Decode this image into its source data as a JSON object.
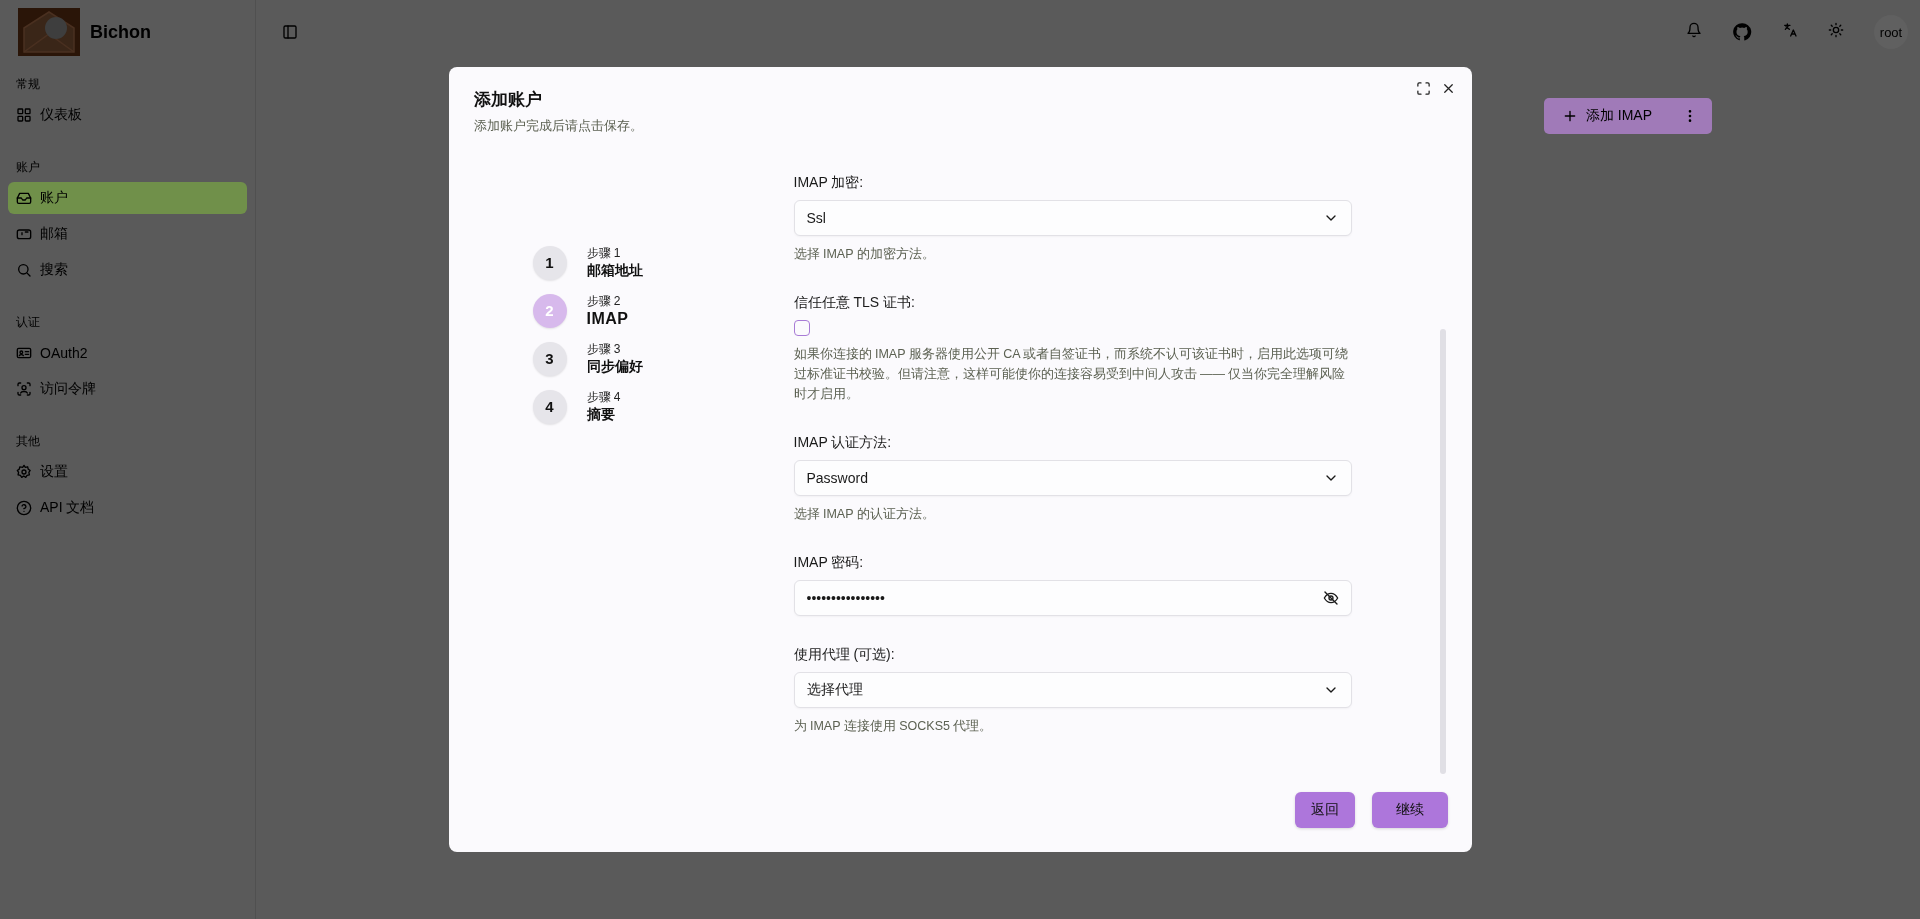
{
  "app": {
    "name": "Bichon"
  },
  "sidebar": {
    "sections": [
      {
        "title": "常规",
        "items": [
          {
            "label": "仪表板",
            "selected": false
          }
        ]
      },
      {
        "title": "账户",
        "items": [
          {
            "label": "账户",
            "selected": true
          },
          {
            "label": "邮箱",
            "selected": false
          },
          {
            "label": "搜索",
            "selected": false
          }
        ]
      },
      {
        "title": "认证",
        "items": [
          {
            "label": "OAuth2",
            "selected": false
          },
          {
            "label": "访问令牌",
            "selected": false
          }
        ]
      },
      {
        "title": "其他",
        "items": [
          {
            "label": "设置",
            "selected": false
          },
          {
            "label": "API 文档",
            "selected": false
          }
        ]
      }
    ]
  },
  "topbar": {
    "user": "root"
  },
  "page": {
    "add_button": "添加 IMAP"
  },
  "dialog": {
    "title": "添加账户",
    "subtitle": "添加账户完成后请点击保存。",
    "steps": [
      {
        "caption": "步骤 1",
        "title": "邮箱地址",
        "number": "1",
        "selected": false
      },
      {
        "caption": "步骤 2",
        "title": "IMAP",
        "number": "2",
        "selected": true
      },
      {
        "caption": "步骤 3",
        "title": "同步偏好",
        "number": "3",
        "selected": false
      },
      {
        "caption": "步骤 4",
        "title": "摘要",
        "number": "4",
        "selected": false
      }
    ],
    "fields": [
      {
        "kind": "select",
        "label": "IMAP 加密:",
        "value": "Ssl",
        "help": "选择 IMAP 的加密方法。"
      },
      {
        "kind": "checkbox",
        "label": "信任任意 TLS 证书:",
        "checked": false,
        "help": "如果你连接的 IMAP 服务器使用公开 CA 或者自签证书，而系统不认可该证书时，启用此选项可绕过标准证书校验。但请注意，这样可能使你的连接容易受到中间人攻击 —— 仅当你完全理解风险时才启用。"
      },
      {
        "kind": "select",
        "label": "IMAP 认证方法:",
        "value": "Password",
        "help": "选择 IMAP 的认证方法。"
      },
      {
        "kind": "password",
        "label": "IMAP 密码:",
        "value": "••••••••••••••••"
      },
      {
        "kind": "select",
        "label": "使用代理 (可选):",
        "value": "选择代理",
        "help": "为 IMAP 连接使用 SOCKS5 代理。"
      }
    ],
    "buttons": [
      {
        "label": "返回"
      },
      {
        "label": "继续"
      }
    ]
  }
}
